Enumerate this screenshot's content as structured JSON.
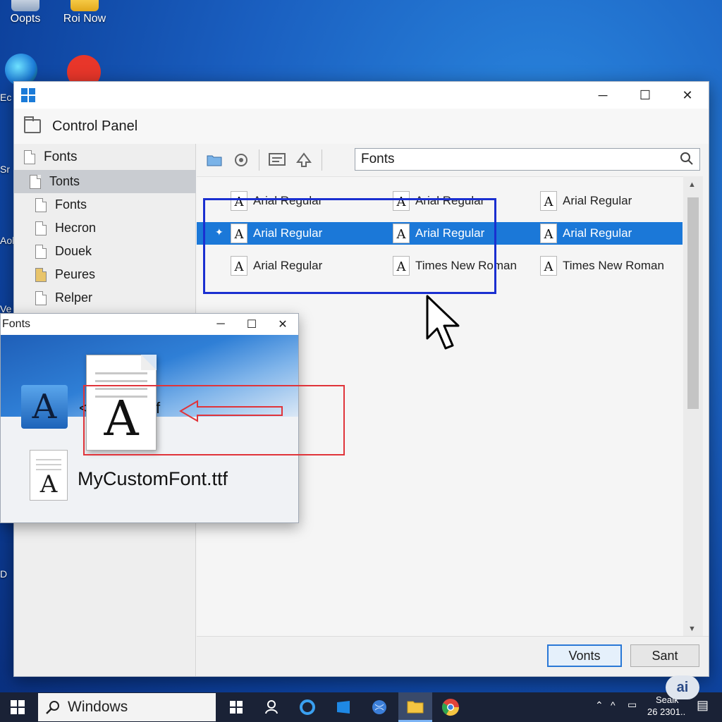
{
  "desktop": {
    "icons": [
      {
        "label": "Oopts"
      },
      {
        "label": "Roi Now"
      }
    ],
    "edge_labels": [
      "Ec",
      "Sr",
      "Aol",
      "Ve",
      "D"
    ]
  },
  "main_window": {
    "address": "Control Panel",
    "sidebar": {
      "header": "Fonts",
      "items": [
        {
          "label": "Tonts",
          "selected": true
        },
        {
          "label": "Fonts"
        },
        {
          "label": "Hecron"
        },
        {
          "label": "Douek"
        },
        {
          "label": "Peures"
        },
        {
          "label": "Relper"
        }
      ]
    },
    "search": {
      "value": "Fonts"
    },
    "fonts_grid": [
      [
        "Arial Regular",
        "Arial Regular",
        "Arial Regular"
      ],
      [
        "Arial Regular",
        "Arial Regular",
        "Arial Regular"
      ],
      [
        "Arial Regular",
        "Times New Roman",
        "Times New Roman"
      ]
    ],
    "font_icon_glyph": "A",
    "pin_glyph": "✦",
    "buttons": {
      "primary": "Vonts",
      "secondary": "Sant"
    }
  },
  "mini_window": {
    "title": "Fonts",
    "truncated_left": "<",
    "truncated_right": "f",
    "file_name": "MyCustomFont.ttf",
    "glyph": "A"
  },
  "taskbar": {
    "search_text": "Windows",
    "tray_line1": "Seaik",
    "tray_line2": "26 2301..",
    "badge": "ai"
  },
  "colors": {
    "accent": "#1b78d8",
    "highlight_box": "#1a2fd0",
    "drop_box": "#e0343a"
  }
}
